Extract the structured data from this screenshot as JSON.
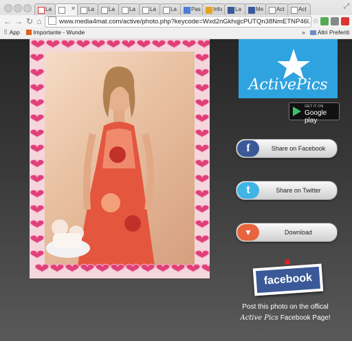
{
  "browser": {
    "tabs": [
      {
        "label": "La"
      },
      {
        "label": ""
      },
      {
        "label": "La"
      },
      {
        "label": "La"
      },
      {
        "label": "La"
      },
      {
        "label": "La"
      },
      {
        "label": "La"
      },
      {
        "label": "Pas"
      },
      {
        "label": "Info"
      },
      {
        "label": "La"
      },
      {
        "label": "Me"
      },
      {
        "label": "Act"
      },
      {
        "label": "Act"
      }
    ],
    "url": "www.media4mat.com/active/photo.php?keycode=Wxd2nGkhqjcPUTQn38NmETNP46l...",
    "bookmarks": {
      "apps": "App",
      "item1": "Importante - Wunde",
      "overflow": "»",
      "other": "Altri Preferiti"
    }
  },
  "sidebar": {
    "logo_text": "ActivePics",
    "google_play_small": "GET IT ON",
    "google_play_big": "Google play",
    "buttons": [
      {
        "label": "Share on Facebook",
        "icon": "f"
      },
      {
        "label": "Share on Twitter",
        "icon": "t"
      },
      {
        "label": "Download",
        "icon": "▼"
      }
    ],
    "facebook_card": "facebook",
    "post_line1": "Post this photo on the offical",
    "post_brand": "Active Pics",
    "post_line2": "Facebook Page!"
  },
  "colors": {
    "facebook": "#3b5998",
    "twitter": "#40b4e5",
    "download": "#e8643c",
    "logo_bg": "#2fa3df",
    "heart": "#e0407a"
  }
}
